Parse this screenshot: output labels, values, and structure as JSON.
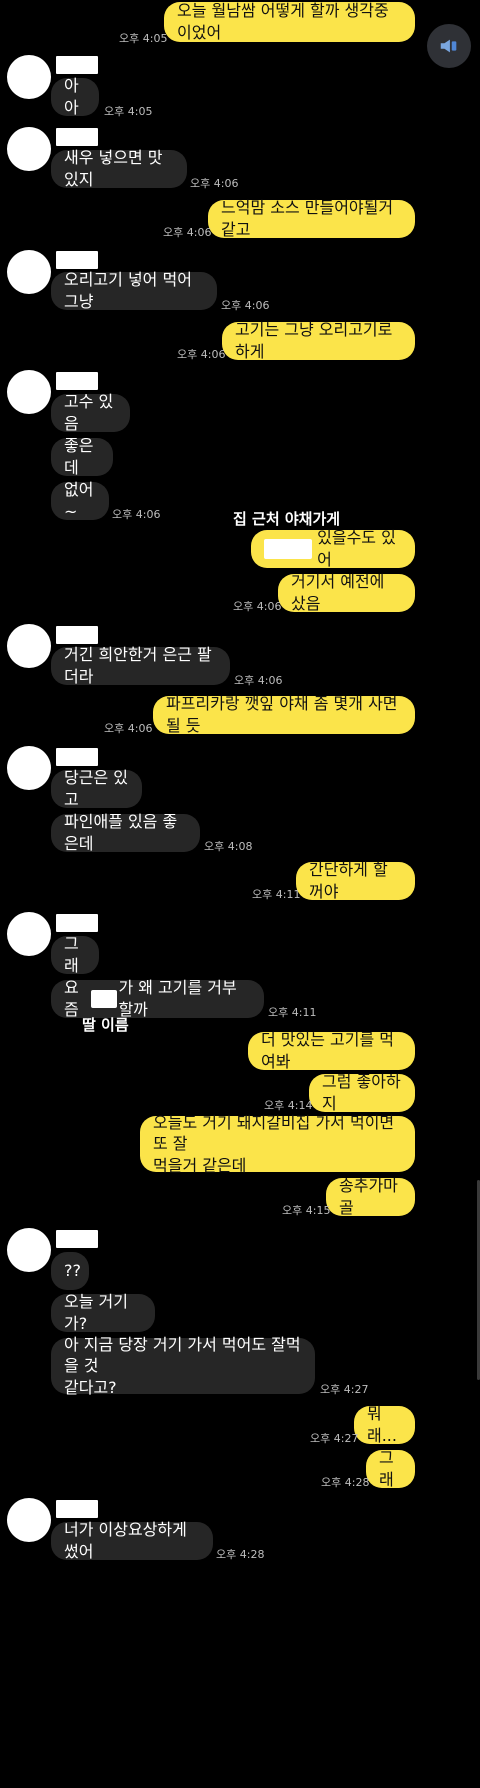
{
  "messages": [
    {
      "text": "오늘 월남쌈 어떻게 할까 생각중이었어",
      "time": "오후 4:05"
    },
    {
      "text": "아아",
      "time": "오후 4:05"
    },
    {
      "text": "새우 넣으면 맛있지",
      "time": "오후 4:06"
    },
    {
      "text": "느억맘 소스 만들어야될거 같고",
      "time": "오후 4:06"
    },
    {
      "text": "오리고기 넣어 먹어 그냥",
      "time": "오후 4:06"
    },
    {
      "text": "고기는 그냥 오리고기로 하게",
      "time": "오후 4:06"
    },
    {
      "text": "고수 있음"
    },
    {
      "text": "좋은데"
    },
    {
      "text": "없어~",
      "time": "오후 4:06"
    },
    {
      "text": "있을수도 있어"
    },
    {
      "text": "거기서 예전에 샀음",
      "time": "오후 4:06"
    },
    {
      "text": "거긴 희안한거 은근 팔더라",
      "time": "오후 4:06"
    },
    {
      "text": "파프리카랑 깻잎 야채 좀 몇개 사면 될 듯",
      "time": "오후 4:06"
    },
    {
      "text": "당근은 있고"
    },
    {
      "text": "파인애플 있음 좋은데",
      "time": "오후 4:08"
    },
    {
      "text": "간단하게 할꺼야",
      "time": "오후 4:11"
    },
    {
      "text": "그래"
    },
    {
      "text_pre": "요즘",
      "text_post": "가 왜 고기를 거부할까",
      "time": "오후 4:11"
    },
    {
      "text": "더 맛있는 고기를 먹여봐"
    },
    {
      "text": "그럼 좋아하지",
      "time": "오후 4:14"
    },
    {
      "text": "오늘도 거기 돼지갈비집 가서 먹이면 또 잘\n먹을거 같은데"
    },
    {
      "text": "송추가마골",
      "time": "오후 4:15"
    },
    {
      "text": "??"
    },
    {
      "text": "오늘 거기 가?"
    },
    {
      "text": "아 지금 당장 거기 가서 먹어도 잘먹을 것\n같다고?",
      "time": "오후 4:27"
    },
    {
      "text": "뭐래...",
      "time": "오후 4:27"
    },
    {
      "text": "그래",
      "time": "오후 4:28"
    },
    {
      "text": "너가 이상요상하게 썼어",
      "time": "오후 4:28"
    }
  ],
  "annotations": {
    "veg_store": "집 근처 야채가게",
    "daughter_name": "딸 이름"
  },
  "fab_icon": "megaphone-icon",
  "colors": {
    "outgoing": "#fbe44a",
    "incoming": "#262626",
    "background": "#000000"
  }
}
